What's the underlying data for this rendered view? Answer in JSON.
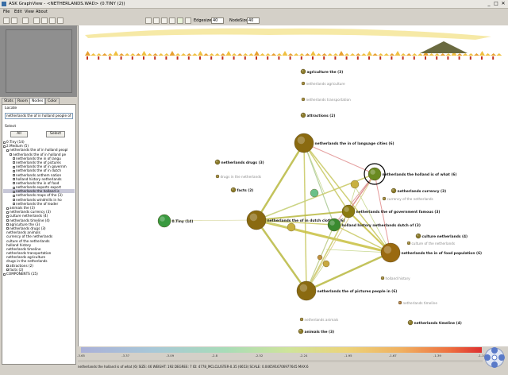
{
  "window": {
    "title": "ASK GraphView - <NETHERLANDS.WAD> (0.TINY (2))",
    "minimize": "_",
    "maximize": "□",
    "close": "✕"
  },
  "menu": [
    "File",
    "Edit",
    "View",
    "About"
  ],
  "toolbar": {
    "edgesize_label": "Edgesize",
    "edgesize_value": "40",
    "nodesize_label": "NodeSize",
    "nodesize_value": "40"
  },
  "left_tabs": [
    "Stats",
    "Room",
    "Nodes",
    "Color"
  ],
  "locate": {
    "label": "Locate",
    "value": "netherlands the of in holland people of (6)"
  },
  "select": {
    "label": "Select",
    "all_button": "All",
    "select_button": "Select"
  },
  "tree": [
    {
      "text": "0.Tiny (14)",
      "indent": 0,
      "toggle": "+"
    },
    {
      "text": "2.Medium (5)",
      "indent": 0,
      "toggle": "-"
    },
    {
      "text": "netherlands the of in holland peopl",
      "indent": 1,
      "toggle": "-"
    },
    {
      "text": "netherlands the of in holland pe",
      "indent": 2,
      "toggle": "-"
    },
    {
      "text": "netherlands the in of langu",
      "indent": 3,
      "toggle": "+"
    },
    {
      "text": "netherlands the of pictures",
      "indent": 3,
      "toggle": "+"
    },
    {
      "text": "netherlands the of in governm",
      "indent": 3,
      "toggle": "+"
    },
    {
      "text": "netherlands the of in dutch",
      "indent": 3,
      "toggle": "+"
    },
    {
      "text": "netherlands anthem nation",
      "indent": 3,
      "toggle": "+"
    },
    {
      "text": "holland history netherlands",
      "indent": 3,
      "toggle": "+"
    },
    {
      "text": "netherlands the in of food",
      "indent": 3,
      "toggle": "+"
    },
    {
      "text": "netherlands exports export",
      "indent": 3,
      "toggle": "+"
    },
    {
      "text": "netherlands the holland is",
      "indent": 3,
      "toggle": "+",
      "selected": true
    },
    {
      "text": "netherlands maps of the (3)",
      "indent": 3,
      "toggle": "+"
    },
    {
      "text": "netherlands windmills in ho",
      "indent": 3,
      "toggle": "+"
    },
    {
      "text": "netherlands the of leader",
      "indent": 3,
      "toggle": "+"
    },
    {
      "text": "animals the (3)",
      "indent": 1,
      "toggle": "+"
    },
    {
      "text": "netherlands currency (3)",
      "indent": 1,
      "toggle": "+"
    },
    {
      "text": "culture netherlands (4)",
      "indent": 1,
      "toggle": "+"
    },
    {
      "text": "netherlands timeline (4)",
      "indent": 1,
      "toggle": "+"
    },
    {
      "text": "agriculture the (3)",
      "indent": 1,
      "toggle": "+"
    },
    {
      "text": "netherlands drugs (3)",
      "indent": 1,
      "toggle": "+"
    },
    {
      "text": "netherlands animals",
      "indent": 1,
      "toggle": ""
    },
    {
      "text": "currency of the netherlands",
      "indent": 1,
      "toggle": ""
    },
    {
      "text": "culture of the netherlands",
      "indent": 1,
      "toggle": ""
    },
    {
      "text": "holland history",
      "indent": 1,
      "toggle": ""
    },
    {
      "text": "netherlands timeline",
      "indent": 1,
      "toggle": ""
    },
    {
      "text": "netherlands transportation",
      "indent": 1,
      "toggle": ""
    },
    {
      "text": "netherlands agriculture",
      "indent": 1,
      "toggle": ""
    },
    {
      "text": "drugs in the netherlands",
      "indent": 1,
      "toggle": ""
    },
    {
      "text": "attractions (2)",
      "indent": 1,
      "toggle": "+"
    },
    {
      "text": "facts (2)",
      "indent": 1,
      "toggle": "+"
    },
    {
      "text": "COMPONENTS (15)",
      "indent": 0,
      "toggle": "+"
    }
  ],
  "graph_nodes": [
    {
      "id": "agri",
      "label": "agriculture the (3)",
      "color": "#8a7a2a",
      "size": "s",
      "bold": true
    },
    {
      "id": "nagri",
      "label": "netherlands agriculture",
      "color": "#a08a3a",
      "size": "xs",
      "bold": false
    },
    {
      "id": "ntrans",
      "label": "netherlands transportation",
      "color": "#a08a3a",
      "size": "xs",
      "bold": false
    },
    {
      "id": "attr",
      "label": "attractions (2)",
      "color": "#8a7a2a",
      "size": "s",
      "bold": true
    },
    {
      "id": "lang",
      "label": "netherlands the in of language cities (6)",
      "color": "#8a6a10",
      "size": "l",
      "bold": true
    },
    {
      "id": "drugs",
      "label": "netherlands drugs (3)",
      "color": "#8a7a2a",
      "size": "s",
      "bold": true
    },
    {
      "id": "drugsin",
      "label": "drugs in the netherlands",
      "color": "#a08a3a",
      "size": "xs",
      "bold": false
    },
    {
      "id": "facts",
      "label": "facts (2)",
      "color": "#8a7a2a",
      "size": "s",
      "bold": true
    },
    {
      "id": "tiny",
      "label": "0.Tiny (14)",
      "color": "#3a9a40",
      "size": "m",
      "bold": true
    },
    {
      "id": "what",
      "label": "netherlands the holland is of what (6)",
      "color": "#6a8a20",
      "size": "m",
      "bold": true
    },
    {
      "id": "curr",
      "label": "netherlands currency (3)",
      "color": "#8a7a2a",
      "size": "s",
      "bold": true
    },
    {
      "id": "currof",
      "label": "currency of the netherlands",
      "color": "#a08a3a",
      "size": "xs",
      "bold": false
    },
    {
      "id": "gov",
      "label": "netherlands the of government famous (3)",
      "color": "#8a7a10",
      "size": "m",
      "bold": true
    },
    {
      "id": "dutch",
      "label": "netherlands the of in dutch clothing (6)",
      "color": "#8a6a10",
      "size": "l",
      "bold": true
    },
    {
      "id": "hist",
      "label": "holland history netherlands dutch of (3)",
      "color": "#3a8a30",
      "size": "m",
      "bold": true
    },
    {
      "id": "cult",
      "label": "culture netherlands (4)",
      "color": "#8a7a2a",
      "size": "s",
      "bold": true
    },
    {
      "id": "cultof",
      "label": "culture of the netherlands",
      "color": "#a08a3a",
      "size": "xs",
      "bold": false
    },
    {
      "id": "food",
      "label": "netherlands the in of food population (6)",
      "color": "#9a6a10",
      "size": "l",
      "bold": true
    },
    {
      "id": "hh",
      "label": "holland history",
      "color": "#a08a3a",
      "size": "xs",
      "bold": false
    },
    {
      "id": "pict",
      "label": "netherlands the of pictures people in (6)",
      "color": "#8a6a10",
      "size": "l",
      "bold": true
    },
    {
      "id": "ntime",
      "label": "netherlands timeline",
      "color": "#b07a40",
      "size": "xs",
      "bold": false
    },
    {
      "id": "time4",
      "label": "netherlands timeline (4)",
      "color": "#8a7a2a",
      "size": "s",
      "bold": true
    },
    {
      "id": "nanim",
      "label": "netherlands animals",
      "color": "#a08a3a",
      "size": "xs",
      "bold": false
    },
    {
      "id": "anim",
      "label": "animals the (3)",
      "color": "#8a7a2a",
      "size": "s",
      "bold": true
    }
  ],
  "legend": {
    "ticks": [
      "-3.65",
      "-3.37",
      "-3.09",
      "-2.8",
      "-2.52",
      "-2.24",
      "-1.95",
      "-1.67",
      "-1.39",
      "-1.10"
    ]
  },
  "status": "netherlands the holland is of what (6)   SIZE: 46   WEIGHT: 192   DEGREE: 7   ID: 4778_MCLCLUSTER-0.35 (6653)   SCALE: 0.0465916706977645   MAX:6"
}
